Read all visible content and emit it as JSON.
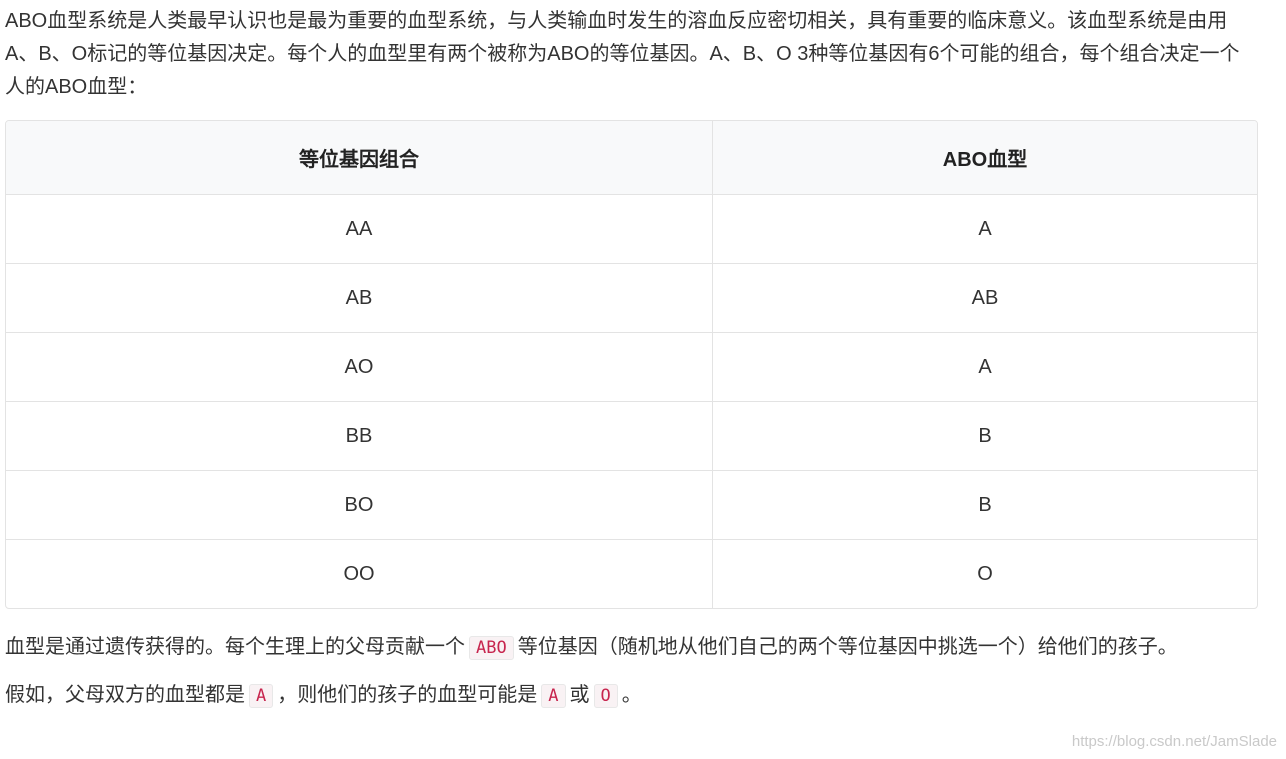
{
  "intro": {
    "text": "ABO血型系统是人类最早认识也是最为重要的血型系统，与人类输血时发生的溶血反应密切相关，具有重要的临床意义。该血型系统是由用A、B、O标记的等位基因决定。每个人的血型里有两个被称为ABO的等位基因。A、B、O 3种等位基因有6个可能的组合，每个组合决定一个人的ABO血型："
  },
  "table": {
    "headers": [
      "等位基因组合",
      "ABO血型"
    ],
    "rows": [
      [
        "AA",
        "A"
      ],
      [
        "AB",
        "AB"
      ],
      [
        "AO",
        "A"
      ],
      [
        "BB",
        "B"
      ],
      [
        "BO",
        "B"
      ],
      [
        "OO",
        "O"
      ]
    ]
  },
  "para2": {
    "before": "血型是通过遗传获得的。每个生理上的父母贡献一个",
    "code": "ABO",
    "after": "等位基因（随机地从他们自己的两个等位基因中挑选一个）给他们的孩子。"
  },
  "para3": {
    "part1": "假如，父母双方的血型都是",
    "code1": "A",
    "part2": "，则他们的孩子的血型可能是",
    "code2": "A",
    "part3": "或",
    "code3": "O",
    "part4": "。"
  },
  "watermark": "https://blog.csdn.net/JamSlade"
}
